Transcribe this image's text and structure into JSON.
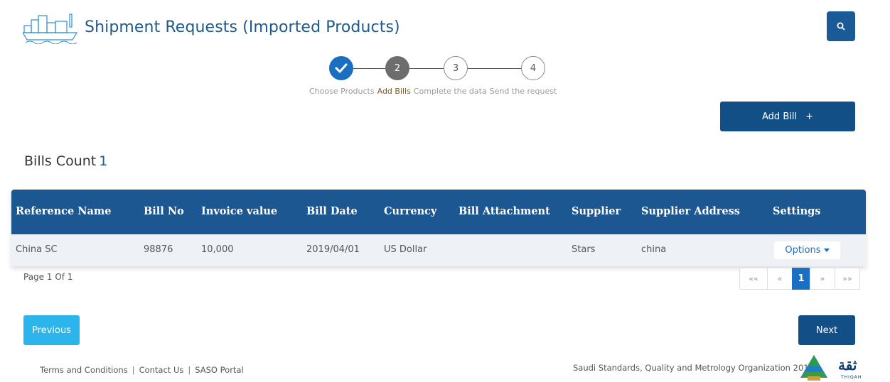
{
  "header": {
    "title": "Shipment Requests (Imported Products)",
    "search_icon": "search-icon",
    "colors": {
      "title": "#1f5a8a",
      "primary": "#134f87",
      "accent": "#1a6fc0"
    }
  },
  "stepper": {
    "steps": [
      {
        "number": "",
        "label": "Choose Products",
        "status": "done",
        "icon": "check-icon"
      },
      {
        "number": "2",
        "label": "Add Bills",
        "status": "active"
      },
      {
        "number": "3",
        "label": "Complete the data",
        "status": "todo"
      },
      {
        "number": "4",
        "label": "Send the request",
        "status": "todo"
      }
    ]
  },
  "add_bill": {
    "label": "Add Bill",
    "icon": "+"
  },
  "bills_count": {
    "label": "Bills Count",
    "value": "1"
  },
  "table": {
    "columns": [
      "Reference Name",
      "Bill No",
      "Invoice value",
      "Bill Date",
      "Currency",
      "Bill Attachment",
      "Supplier",
      "Supplier Address",
      "Settings"
    ],
    "rows": [
      {
        "reference_name": "China SC",
        "bill_no": "98876",
        "invoice_value": "10,000",
        "bill_date": "2019/04/01",
        "currency": "US Dollar",
        "bill_attachment": "",
        "supplier": "Stars",
        "supplier_address": "china",
        "options_label": "Options"
      }
    ]
  },
  "pagination": {
    "info": "Page 1 Of 1",
    "first": "««",
    "prev": "«",
    "current": "1",
    "next": "»",
    "last": "»»"
  },
  "nav": {
    "previous": "Previous",
    "next": "Next"
  },
  "footer": {
    "links": [
      "Terms and Conditions",
      "Contact Us",
      "SASO Portal"
    ],
    "separator": "|",
    "org": "Saudi Standards, Quality and Metrology Organization 2019",
    "thiqah_arabic": "ثقة",
    "thiqah_latin": "THIQAH"
  }
}
